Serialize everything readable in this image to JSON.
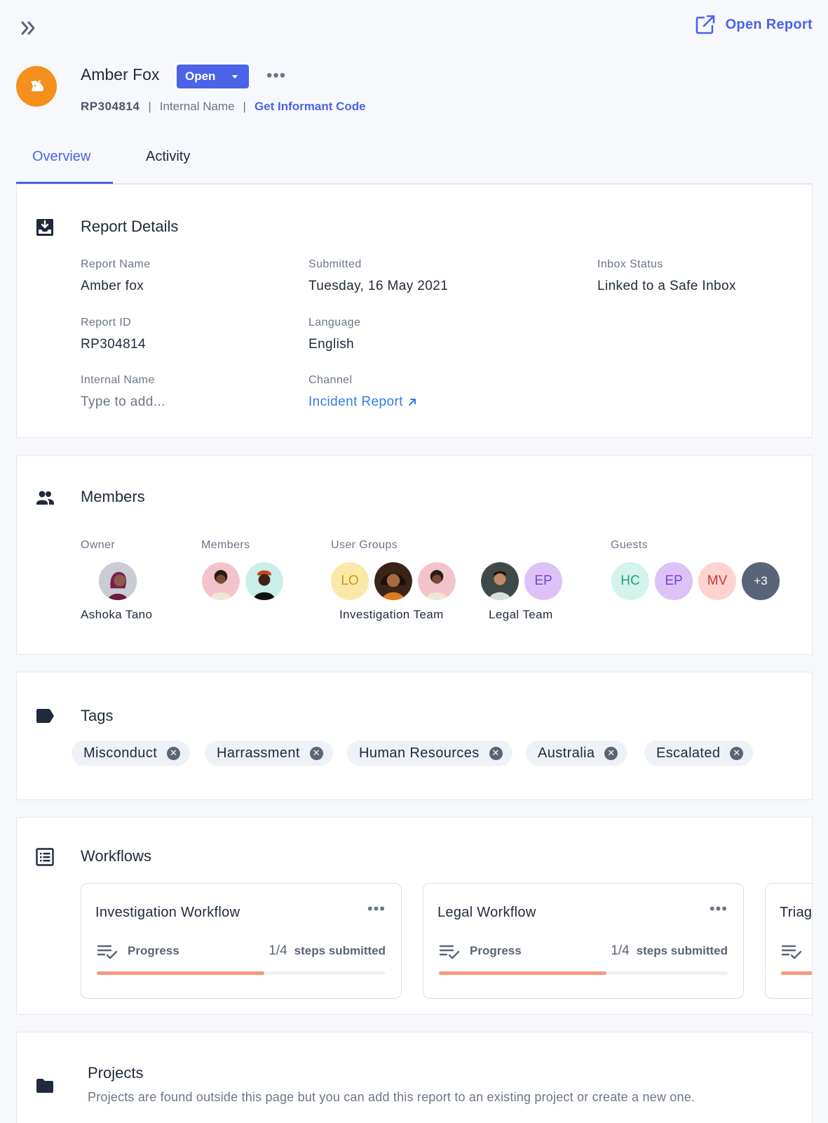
{
  "header": {
    "open_report_label": "Open Report",
    "title": "Amber Fox",
    "status": "Open",
    "report_id": "RP304814",
    "internal_name_label": "Internal Name",
    "informant_link": "Get Informant Code",
    "separator": "|"
  },
  "tabs": [
    {
      "label": "Overview",
      "active": true
    },
    {
      "label": "Activity",
      "active": false
    }
  ],
  "report_details": {
    "title": "Report Details",
    "report_name_label": "Report Name",
    "report_name": "Amber fox",
    "submitted_label": "Submitted",
    "submitted": "Tuesday, 16 May 2021",
    "inbox_status_label": "Inbox Status",
    "inbox_status": "Linked to a Safe Inbox",
    "report_id_label": "Report ID",
    "report_id": "RP304814",
    "language_label": "Language",
    "language": "English",
    "internal_name_label": "Internal Name",
    "internal_name_placeholder": "Type to add...",
    "channel_label": "Channel",
    "channel": "Incident Report"
  },
  "members": {
    "title": "Members",
    "owner_label": "Owner",
    "owner_name": "Ashoka Tano",
    "members_label": "Members",
    "user_groups_label": "User Groups",
    "groups": [
      {
        "name": "Investigation Team",
        "initials": "LO"
      },
      {
        "name": "Legal Team",
        "initials": "EP"
      }
    ],
    "guests_label": "Guests",
    "guests": [
      "HC",
      "EP",
      "MV",
      "+3"
    ]
  },
  "tags": {
    "title": "Tags",
    "items": [
      "Misconduct",
      "Harrassment",
      "Human Resources",
      "Australia",
      "Escalated"
    ]
  },
  "workflows": {
    "title": "Workflows",
    "items": [
      {
        "title": "Investigation Workflow",
        "progress_label": "Progress",
        "steps": "1/4",
        "steps_text": "steps submitted",
        "progress": 0.58
      },
      {
        "title": "Legal Workflow",
        "progress_label": "Progress",
        "steps": "1/4",
        "steps_text": "steps submitted",
        "progress": 0.58
      },
      {
        "title": "Triag",
        "progress_label": "",
        "steps": "",
        "steps_text": "",
        "progress": 0.58
      }
    ]
  },
  "projects": {
    "title": "Projects",
    "description": "Projects are found outside this page but you can add this report to an existing project or create a new one."
  },
  "colors": {
    "accent": "#4a63e8",
    "avatar_main": "#f4901e",
    "progress": "#f59a7b",
    "link": "#2f7de1"
  }
}
